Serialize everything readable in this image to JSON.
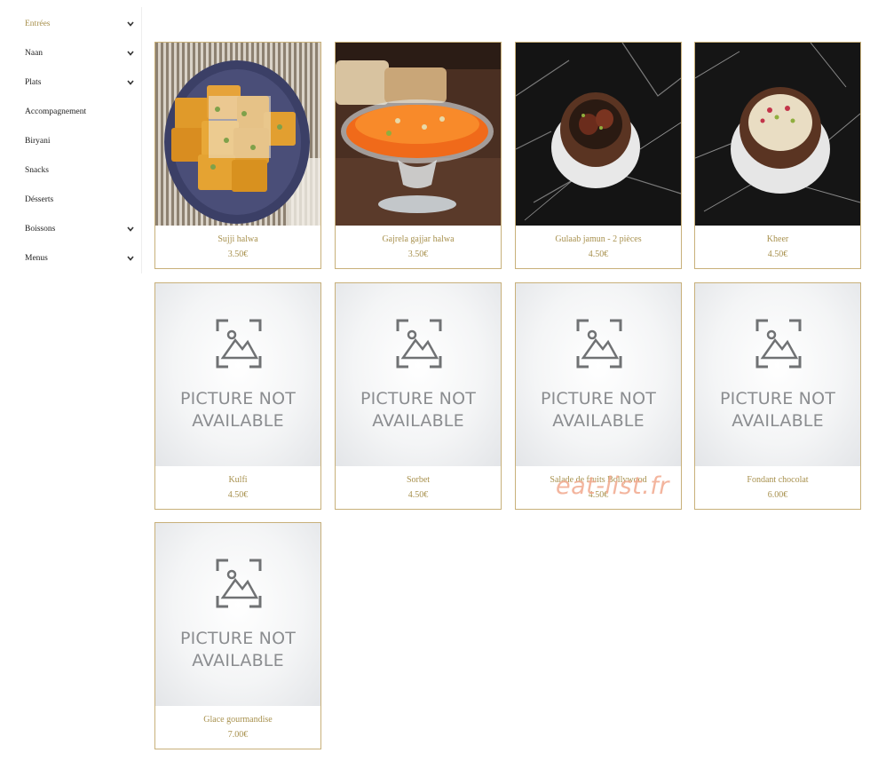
{
  "sidebar": {
    "items": [
      {
        "label": "Entrées",
        "has_dropdown": true,
        "active": true
      },
      {
        "label": "Naan",
        "has_dropdown": true
      },
      {
        "label": "Plats",
        "has_dropdown": true
      },
      {
        "label": "Accompagnement",
        "has_dropdown": false
      },
      {
        "label": "Biryani",
        "has_dropdown": false
      },
      {
        "label": "Snacks",
        "has_dropdown": false
      },
      {
        "label": "Désserts",
        "has_dropdown": false
      },
      {
        "label": "Boissons",
        "has_dropdown": true
      },
      {
        "label": "Menus",
        "has_dropdown": true
      }
    ]
  },
  "products": [
    {
      "name": "Sujji halwa",
      "price": "3.50€",
      "image": "sujji-halwa-photo"
    },
    {
      "name": "Gajrela gajjar halwa",
      "price": "3.50€",
      "image": "gajrela-halwa-photo"
    },
    {
      "name": "Gulaab jamun - 2 pièces",
      "price": "4.50€",
      "image": "gulab-jamun-photo"
    },
    {
      "name": "Kheer",
      "price": "4.50€",
      "image": "kheer-photo"
    },
    {
      "name": "Kulfi",
      "price": "4.50€",
      "image": "placeholder"
    },
    {
      "name": "Sorbet",
      "price": "4.50€",
      "image": "placeholder"
    },
    {
      "name": "Salade de fruits Bollywood",
      "price": "4.50€",
      "image": "placeholder"
    },
    {
      "name": "Fondant chocolat",
      "price": "6.00€",
      "image": "placeholder"
    },
    {
      "name": "Glace gourmandise",
      "price": "7.00€",
      "image": "placeholder"
    }
  ],
  "placeholder": {
    "line1": "PICTURE NOT",
    "line2": "AVAILABLE"
  },
  "watermark": "eat-list.fr",
  "colors": {
    "accent": "#a8914e",
    "card_border": "#c8b07a"
  }
}
